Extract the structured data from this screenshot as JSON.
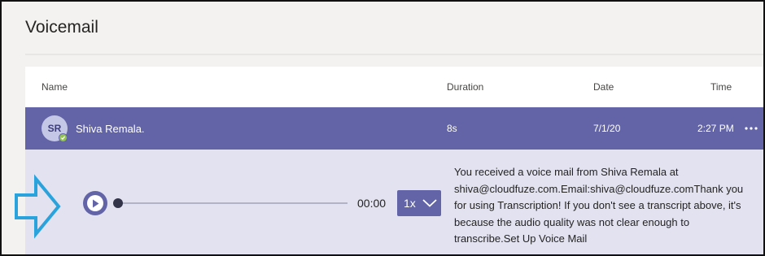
{
  "page": {
    "title": "Voicemail"
  },
  "columns": {
    "name": "Name",
    "duration": "Duration",
    "date": "Date",
    "time": "Time"
  },
  "voicemails": [
    {
      "initials": "SR",
      "name": "Shiva Remala.",
      "duration": "8s",
      "date": "7/1/20",
      "time": "2:27 PM",
      "presence": "available"
    }
  ],
  "player": {
    "elapsed": "00:00",
    "speed": "1x",
    "progress": 0
  },
  "transcript": "You received a voice mail from Shiva Remala at shiva@cloudfuze.com.Email:shiva@cloudfuze.comThank you for using Transcription! If you don't see a transcript above, it's because the audio quality was not clear enough to transcribe.Set Up Voice Mail",
  "colors": {
    "accent": "#6264a7",
    "expanded_bg": "#e2e2f0",
    "presence_available": "#92c353",
    "annotation_arrow": "#2aa3dc"
  },
  "icons": {
    "play": "play-icon",
    "speed_dropdown": "chevron-down-icon",
    "more": "more-options-icon",
    "presence": "presence-available-icon",
    "annotation": "arrow-right-icon"
  }
}
